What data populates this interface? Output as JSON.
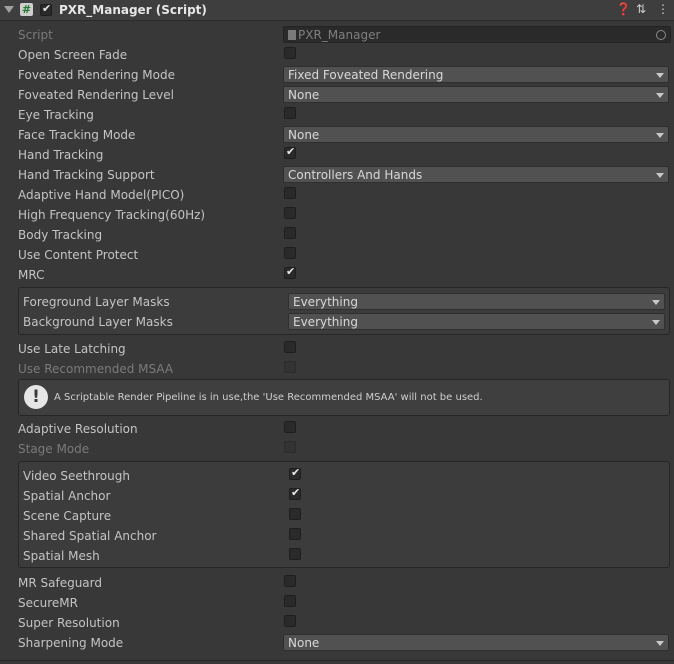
{
  "header": {
    "title": "PXR_Manager (Script)",
    "enabled": true,
    "icons": [
      "fold-arrow-icon",
      "script-icon",
      "help-icon",
      "preset-icon",
      "more-options-icon"
    ]
  },
  "fields": {
    "script": {
      "label": "Script",
      "value": "PXR_Manager"
    },
    "open_screen_fade": {
      "label": "Open Screen Fade",
      "checked": false
    },
    "foveated_mode": {
      "label": "Foveated Rendering Mode",
      "value": "Fixed Foveated Rendering"
    },
    "foveated_level": {
      "label": "Foveated Rendering Level",
      "value": "None"
    },
    "eye_tracking": {
      "label": "Eye Tracking",
      "checked": false
    },
    "face_tracking_mode": {
      "label": "Face Tracking Mode",
      "value": "None"
    },
    "hand_tracking": {
      "label": "Hand Tracking",
      "checked": true
    },
    "hand_tracking_support": {
      "label": "Hand Tracking Support",
      "value": "Controllers And Hands"
    },
    "adaptive_hand_model": {
      "label": "Adaptive Hand Model(PICO)",
      "checked": false
    },
    "high_freq_tracking": {
      "label": "High Frequency Tracking(60Hz)",
      "checked": false
    },
    "body_tracking": {
      "label": "Body Tracking",
      "checked": false
    },
    "content_protect": {
      "label": "Use Content Protect",
      "checked": false
    },
    "mrc": {
      "label": "MRC",
      "checked": true
    },
    "foreground_masks": {
      "label": "Foreground Layer Masks",
      "value": "Everything"
    },
    "background_masks": {
      "label": "Background Layer Masks",
      "value": "Everything"
    },
    "late_latching": {
      "label": "Use Late Latching",
      "checked": false
    },
    "recommended_msaa": {
      "label": "Use Recommended MSAA",
      "checked": false,
      "disabled": true
    },
    "help_message": "A Scriptable Render Pipeline is in use,the 'Use Recommended MSAA' will not be used.",
    "adaptive_resolution": {
      "label": "Adaptive Resolution",
      "checked": false
    },
    "stage_mode": {
      "label": "Stage Mode",
      "checked": false,
      "disabled": true
    },
    "video_seethrough": {
      "label": "Video Seethrough",
      "checked": true
    },
    "spatial_anchor": {
      "label": "Spatial Anchor",
      "checked": true
    },
    "scene_capture": {
      "label": "Scene Capture",
      "checked": false
    },
    "shared_spatial_anchor": {
      "label": "Shared Spatial Anchor",
      "checked": false
    },
    "spatial_mesh": {
      "label": "Spatial Mesh",
      "checked": false
    },
    "mr_safeguard": {
      "label": "MR Safeguard",
      "checked": false
    },
    "secure_mr": {
      "label": "SecureMR",
      "checked": false
    },
    "super_resolution": {
      "label": "Super Resolution",
      "checked": false
    },
    "sharpening_mode": {
      "label": "Sharpening Mode",
      "value": "None"
    }
  }
}
